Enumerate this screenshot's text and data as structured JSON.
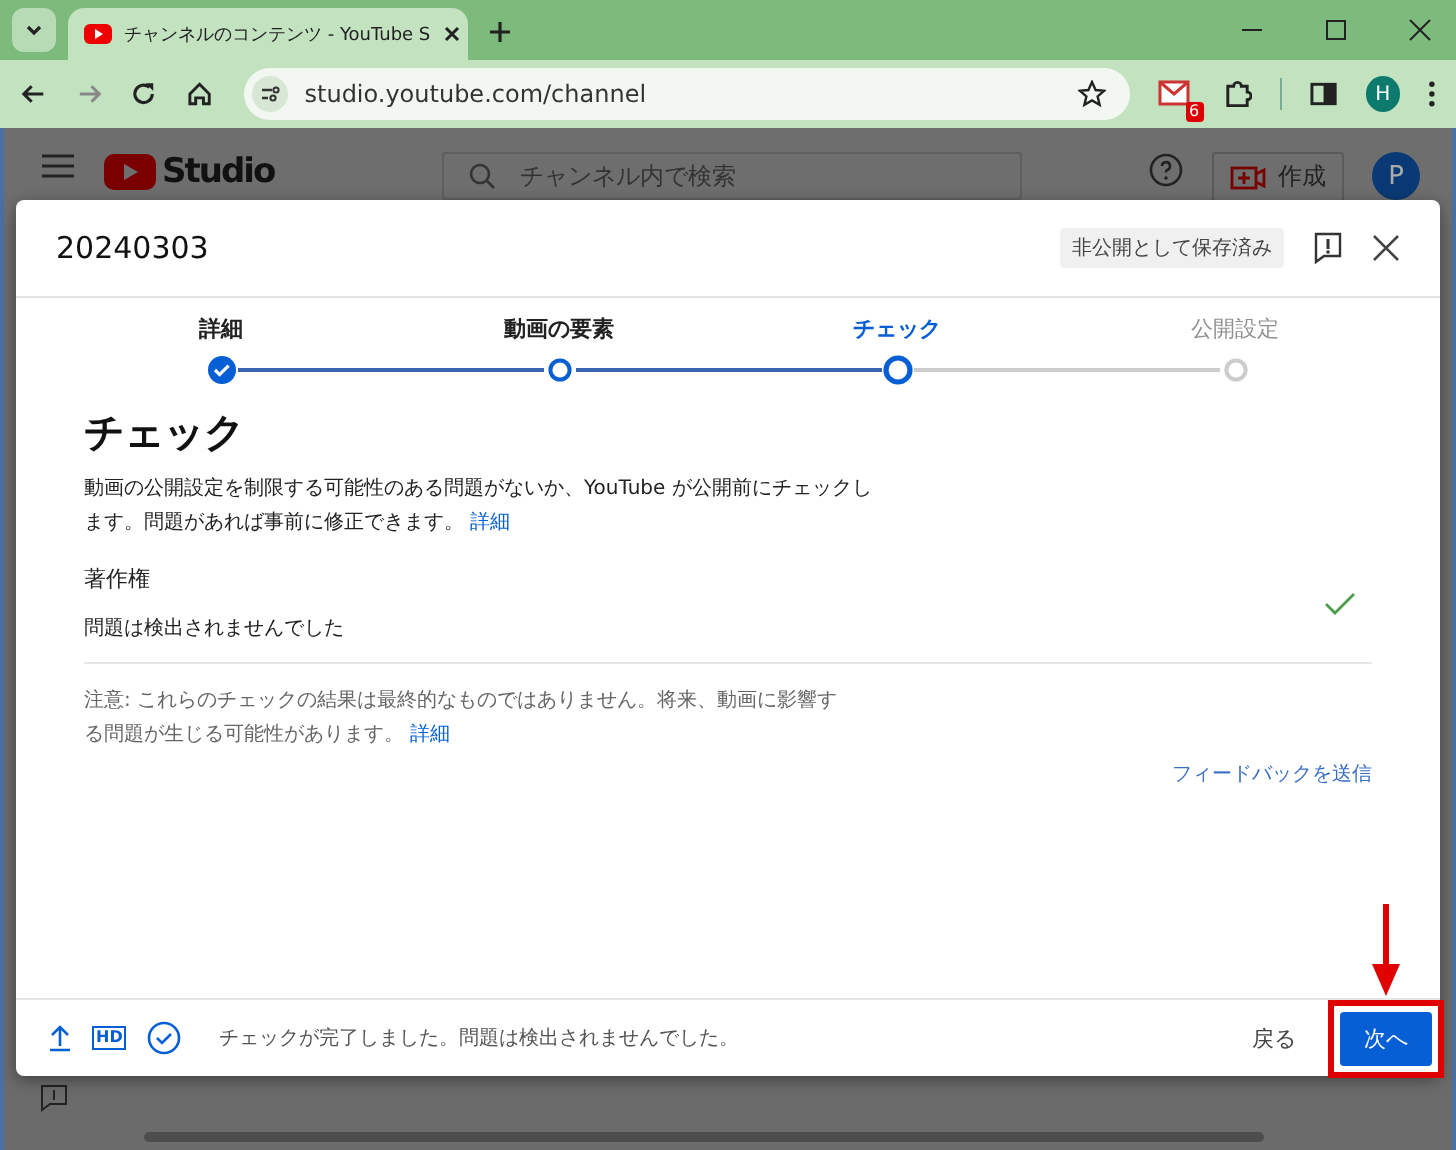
{
  "browser": {
    "tab_title": "チャンネルのコンテンツ - YouTube S",
    "url": "studio.youtube.com/channel",
    "mail_count": "6",
    "profile_initial": "H"
  },
  "studio_header": {
    "logo_text": "Studio",
    "search_placeholder": "チャンネル内で検索",
    "create_label": "作成",
    "avatar_initial": "P"
  },
  "dialog": {
    "title": "20240303",
    "save_status": "非公開として保存済み",
    "steps": [
      {
        "label": "詳細",
        "completed": true,
        "enabled": true,
        "selected": false
      },
      {
        "label": "動画の要素",
        "completed": false,
        "enabled": true,
        "selected": false
      },
      {
        "label": "チェック",
        "completed": false,
        "enabled": true,
        "selected": true
      },
      {
        "label": "公開設定",
        "completed": false,
        "enabled": false,
        "selected": false
      }
    ],
    "heading": "チェック",
    "description": "動画の公開設定を制限する可能性のある問題がないか、YouTube が公開前にチェックします。問題があれば事前に修正できます。",
    "description_link": "詳細",
    "checks": [
      {
        "title": "著作権",
        "result": "問題は検出されませんでした",
        "passed": true
      }
    ],
    "note": "注意: これらのチェックの結果は最終的なものではありません。将来、動画に影響する問題が生じる可能性があります。",
    "note_link": "詳細",
    "feedback_link": "フィードバックを送信",
    "footer_status": "チェックが完了しました。問題は検出されませんでした。",
    "back_button": "戻る",
    "next_button": "次へ",
    "hd_badge": "HD"
  }
}
